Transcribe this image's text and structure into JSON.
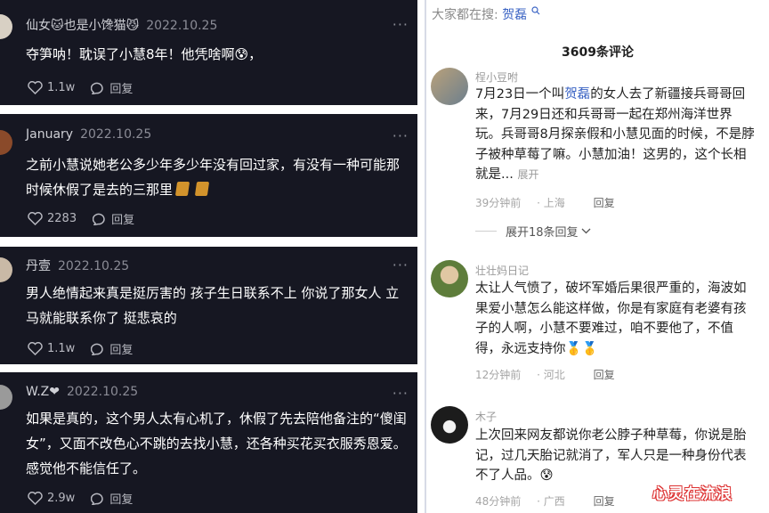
{
  "left_comments": [
    {
      "user": "仙女🐱也是小馋猫😼",
      "date": "2022.10.25",
      "text": "夺笋呐！耽误了小慧8年！他凭啥啊😰，",
      "likes": "1.1w",
      "reply_label": "回复"
    },
    {
      "user": "January",
      "date": "2022.10.25",
      "text": "之前小慧说她老公多少年多少年没有回过家，有没有一种可能那时候休假了是去的三那里",
      "likes": "2283",
      "reply_label": "回复"
    },
    {
      "user": "丹壹",
      "date": "2022.10.25",
      "text": "男人绝情起来真是挺厉害的 孩子生日联系不上 你说了那女人 立马就能联系你了 挺悲哀的",
      "likes": "1.1w",
      "reply_label": "回复"
    },
    {
      "user": "W.Z❤",
      "date": "2022.10.25",
      "text": "如果是真的，这个男人太有心机了，休假了先去陪他备注的“傻闺女”，又面不改色心不跳的去找小慧，还各种买花买衣服秀恩爱。感觉他不能信任了。",
      "likes": "2.9w",
      "reply_label": "回复"
    }
  ],
  "right_panel": {
    "search_prefix": "大家都在搜:",
    "search_keyword": "贺磊",
    "comment_count": "3609条评论",
    "comments": [
      {
        "user": "桯小豆咐",
        "text_before": "7月23日一个叫",
        "keyword": "贺磊",
        "text_after": "的女人去了新疆接兵哥哥回来，7月29日还和兵哥哥一起在郑州海洋世界玩。兵哥哥8月探亲假和小慧见面的时候，不是脖子被种草莓了嘛。小慧加油！这男的，这个长相就是...",
        "expand_label": "展开",
        "time": "39分钟前",
        "location": "上海",
        "reply_label": "回复"
      },
      {
        "user": "壮壮妈日记",
        "text": "太让人气愤了，破坏军婚后果很严重的，海波如果爱小慧怎么能这样做，你是有家庭有老婆有孩子的人啊，小慧不要难过，咱不要他了，不值得，永远支持你🥇🥇",
        "time": "12分钟前",
        "location": "河北",
        "reply_label": "回复"
      },
      {
        "user": "木子",
        "text": "上次回来网友都说你老公脖子种草莓，你说是胎记，过几天胎记就消了，军人只是一种身份代表不了人品。😰",
        "time": "48分钟前",
        "location": "广西",
        "reply_label": "回复"
      }
    ],
    "expand_replies_label": "展开18条回复",
    "watermark": "心灵在流浪"
  }
}
